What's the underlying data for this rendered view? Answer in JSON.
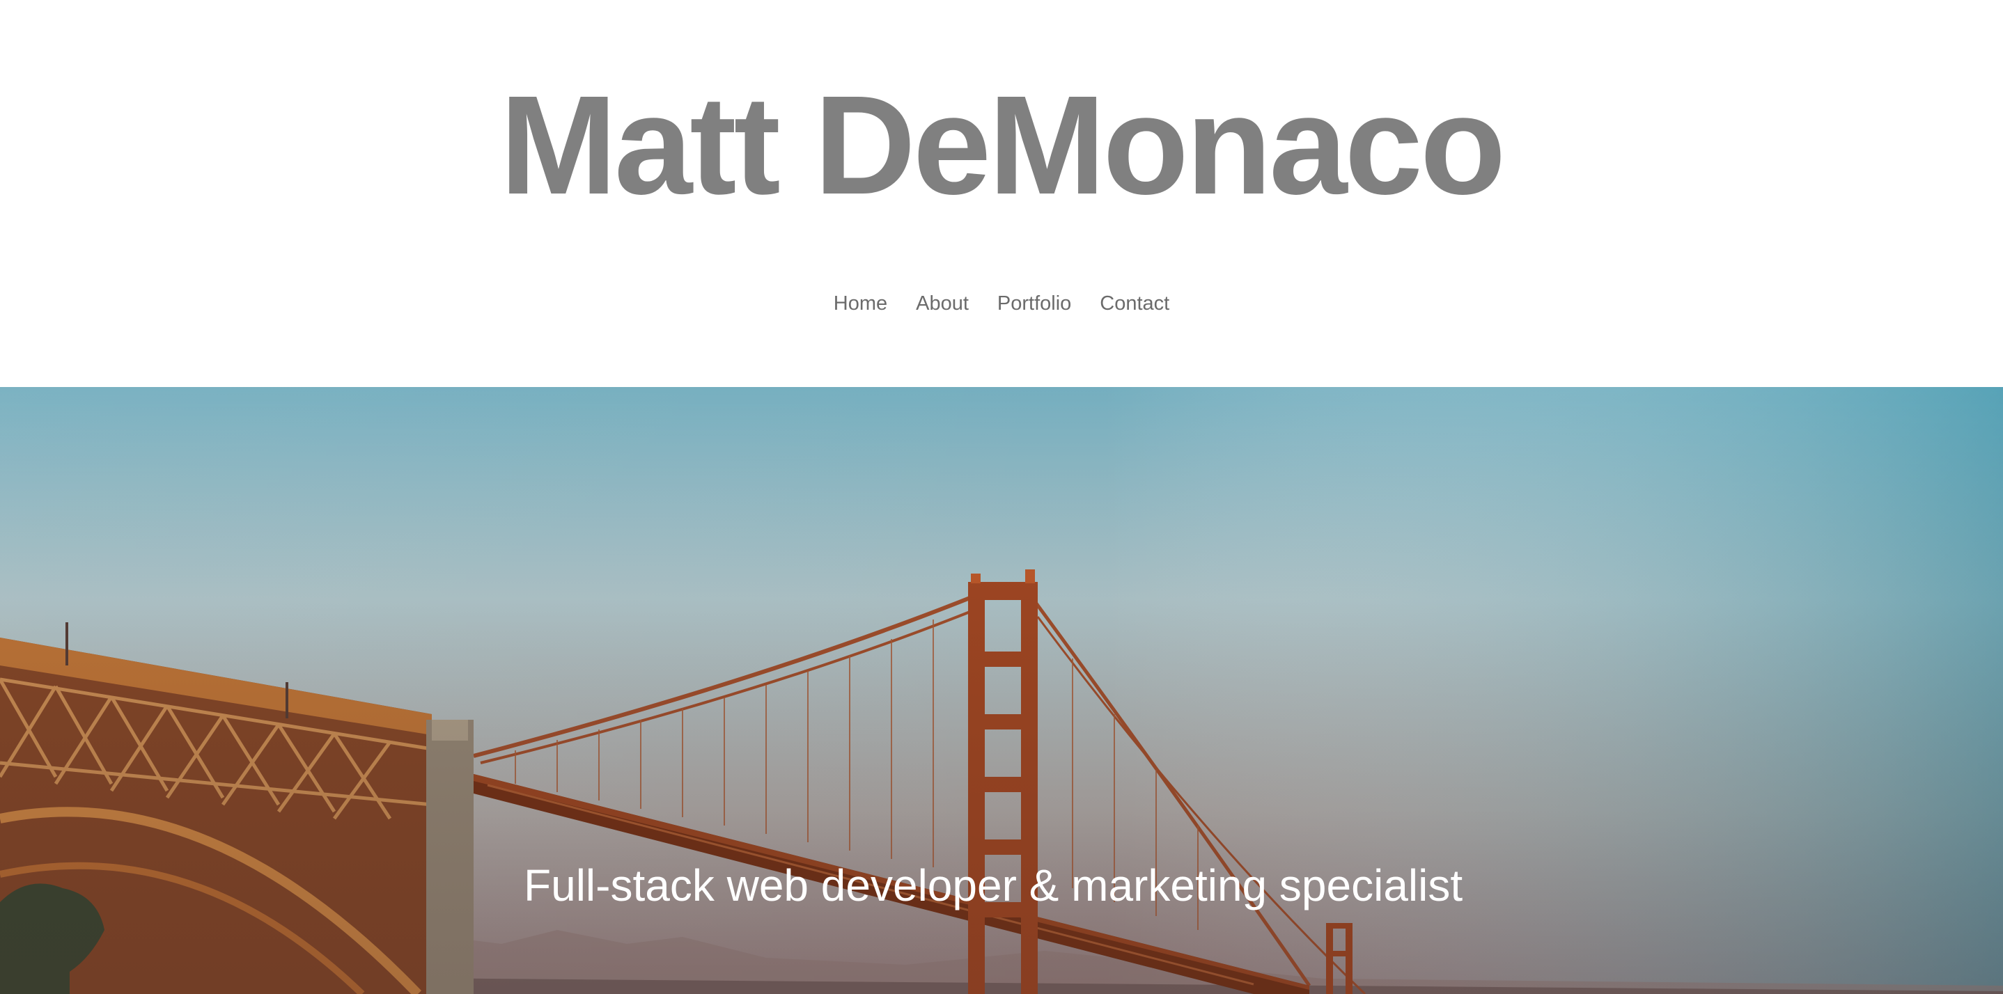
{
  "site": {
    "title": "Matt DeMonaco"
  },
  "nav": {
    "items": [
      {
        "label": "Home"
      },
      {
        "label": "About"
      },
      {
        "label": "Portfolio"
      },
      {
        "label": "Contact"
      }
    ]
  },
  "hero": {
    "tagline": "Full-stack web developer & marketing specialist",
    "image_subject": "Golden Gate Bridge at dusk"
  },
  "colors": {
    "title": "#808080",
    "nav_link": "#6b6b6b",
    "tagline": "#ffffff",
    "sky_top": "#5fa6b8",
    "bridge": "#b5532b"
  }
}
